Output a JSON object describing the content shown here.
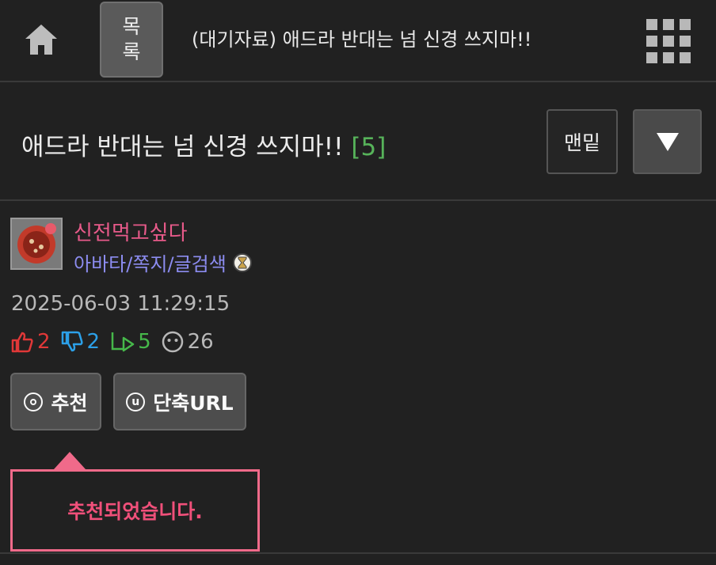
{
  "topbar": {
    "list_label": "목록",
    "title": "(대기자료) 애드라 반대는 넘 신경 쓰지마!!",
    "home_icon": "home-icon",
    "grid_icon": "grid-menu-icon"
  },
  "post": {
    "title": "애드라 반대는 넘 신경 쓰지마!!",
    "comment_count": "[5]",
    "bottom_label": "맨밑",
    "down_icon": "down-triangle-icon"
  },
  "author": {
    "name": "신전먹고싶다",
    "links": "아바타/쪽지/글검색"
  },
  "meta": {
    "datetime": "2025-06-03 11:29:15",
    "upvotes": "2",
    "downvotes": "2",
    "replies": "5",
    "views": "26"
  },
  "actions": {
    "recommend_label": "추천",
    "short_url_label": "단축URL",
    "short_url_glyph": "u"
  },
  "tooltip": {
    "message": "추천되었습니다."
  },
  "colors": {
    "background": "#212121",
    "author": "#e85a8a",
    "links": "#8c8cf0",
    "upvote": "#e03838",
    "downvote": "#2ca0e8",
    "reply": "#46b84a",
    "comment_count": "#57b35a",
    "tooltip": "#f06a8a"
  }
}
